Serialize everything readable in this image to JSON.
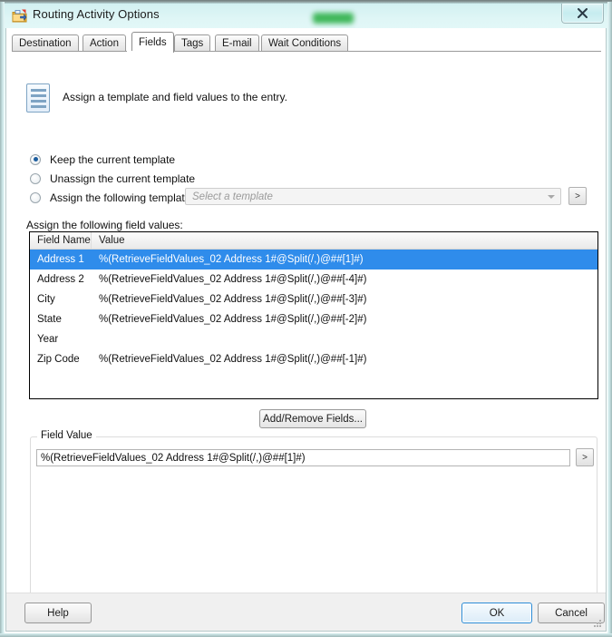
{
  "window": {
    "title": "Routing Activity Options",
    "icon": "routing-folder-icon",
    "close_label": "✖"
  },
  "tabs": [
    {
      "label": "Destination",
      "active": false
    },
    {
      "label": "Action",
      "active": false
    },
    {
      "label": "Fields",
      "active": true
    },
    {
      "label": "Tags",
      "active": false
    },
    {
      "label": "E-mail",
      "active": false
    },
    {
      "label": "Wait Conditions",
      "active": false
    }
  ],
  "header": {
    "icon": "template-document-icon",
    "description": "Assign a template and field values to the entry."
  },
  "template_options": {
    "radios": [
      {
        "label": "Keep the current template",
        "checked": true
      },
      {
        "label": "Unassign the current template",
        "checked": false
      },
      {
        "label": "Assign the following template:",
        "checked": false
      }
    ],
    "combo": {
      "placeholder": "Select a template",
      "value": "",
      "disabled": true,
      "arrow_icon": "chevron-down-icon"
    },
    "browse_label": ">"
  },
  "field_values": {
    "section_label": "Assign the following field values:",
    "columns": [
      "Field Name",
      "Value"
    ],
    "rows": [
      {
        "name": "Address 1",
        "value": "%(RetrieveFieldValues_02 Address 1#@Split(/,)@##[1]#)",
        "selected": true
      },
      {
        "name": "Address 2",
        "value": "%(RetrieveFieldValues_02 Address 1#@Split(/,)@##[-4]#)",
        "selected": false
      },
      {
        "name": "City",
        "value": "%(RetrieveFieldValues_02 Address 1#@Split(/,)@##[-3]#)",
        "selected": false
      },
      {
        "name": "State",
        "value": "%(RetrieveFieldValues_02 Address 1#@Split(/,)@##[-2]#)",
        "selected": false
      },
      {
        "name": "Year",
        "value": "",
        "selected": false
      },
      {
        "name": "Zip Code",
        "value": "%(RetrieveFieldValues_02 Address 1#@Split(/,)@##[-1]#)",
        "selected": false
      }
    ],
    "add_remove_label": "Add/Remove Fields..."
  },
  "field_value_panel": {
    "legend": "Field Value",
    "value": "%(RetrieveFieldValues_02 Address 1#@Split(/,)@##[1]#)",
    "placeholder": "",
    "browse_label": ">"
  },
  "footer": {
    "help_label": "Help",
    "ok_label": "OK",
    "cancel_label": "Cancel"
  },
  "colors": {
    "selection_blue": "#2f8ceb",
    "default_button_border": "#2a8bd6",
    "aero_glass": "#d6f2f4",
    "redaction_green": "#2fb14a"
  }
}
